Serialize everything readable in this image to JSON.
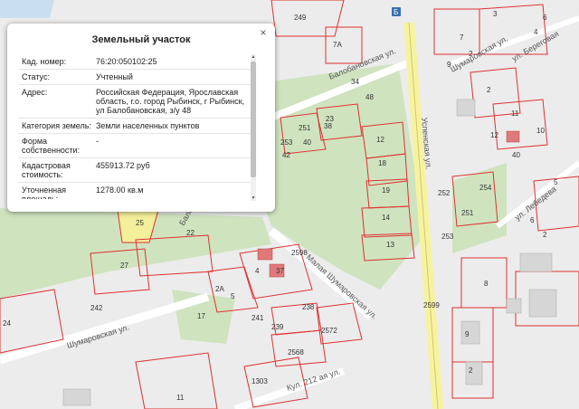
{
  "popup": {
    "title": "Земельный участок",
    "close_glyph": "×",
    "rows": [
      {
        "label": "Кад. номер:",
        "value": "76:20:050102:25"
      },
      {
        "label": "Статус:",
        "value": "Учтенный"
      },
      {
        "label": "Адрес:",
        "value": "Российская Федерация, Ярославская область, г.о. город Рыбинск, г Рыбинск, ул Балобановская, з/у 48"
      },
      {
        "label": "Категория земель:",
        "value": "Земли населенных пунктов"
      },
      {
        "label": "Форма собственности:",
        "value": "-"
      },
      {
        "label": "Кадастровая стоимость:",
        "value": "455913.72 руб"
      },
      {
        "label": "Уточненная площадь:",
        "value": "1278.00 кв.м"
      }
    ]
  },
  "map": {
    "streets": [
      "Балобановская ул.",
      "Успенская ул.",
      "Шумаровская ул.",
      "Шумаровская ул.",
      "Малая Шумаровская ул.",
      "ул. Береговая",
      "ул. Лебедева",
      "Балоб",
      "Кул. 212 ая ул."
    ],
    "parcel_labels": [
      "249",
      "7A",
      "34",
      "23",
      "251",
      "253",
      "40",
      "42",
      "12",
      "18",
      "19",
      "14",
      "13",
      "25",
      "22",
      "27",
      "242",
      "24",
      "2A",
      "5",
      "4",
      "37",
      "17",
      "241",
      "239",
      "238",
      "2572",
      "2568",
      "1303",
      "11",
      "2598",
      "2599",
      "252",
      "253",
      "254",
      "251",
      "2",
      "11",
      "12",
      "40",
      "10",
      "5",
      "6",
      "7",
      "9",
      "2",
      "6",
      "4",
      "3",
      "8",
      "9",
      "2",
      "38",
      "48",
      "2"
    ],
    "bus_stop_glyph": "Б"
  },
  "colors": {
    "background": "#ececec",
    "parcel_border": "#e03030",
    "forest": "#cfe3bf",
    "road": "#ffffff",
    "main_road": "#f6f3a0",
    "highlight": "#f3ef9a",
    "building": "#d6d6d6",
    "water": "#c9dff0"
  }
}
